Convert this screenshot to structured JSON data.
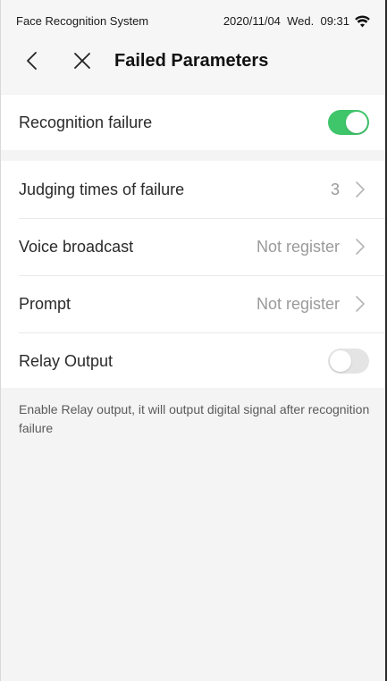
{
  "status_bar": {
    "app_name": "Face Recognition System",
    "datetime": "2020/11/04  Wed.  09:31",
    "wifi_icon": "wifi-icon"
  },
  "nav": {
    "title": "Failed Parameters",
    "back_icon": "chevron-left-icon",
    "close_icon": "close-icon"
  },
  "recognition_failure": {
    "label": "Recognition failure",
    "enabled": true
  },
  "settings": [
    {
      "label": "Judging times of failure",
      "value": "3"
    },
    {
      "label": "Voice broadcast",
      "value": "Not register"
    },
    {
      "label": "Prompt",
      "value": "Not register"
    }
  ],
  "relay_output": {
    "label": "Relay Output",
    "enabled": false
  },
  "footnote": "Enable Relay output, it will output digital signal after recognition failure",
  "colors": {
    "toggle_on": "#3fc56a",
    "toggle_off": "#e4e4e4",
    "background": "#f4f4f4"
  }
}
